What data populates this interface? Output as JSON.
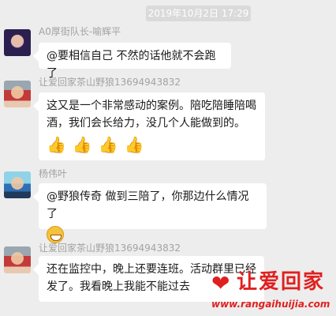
{
  "timestamp": "2019年10月2日 17:29",
  "messages": [
    {
      "sender": "A0厚街队长-喻辉平",
      "text": "@要相信自己 不然的话他就不会跑了",
      "avatar_icon": "user-avatar-icon"
    },
    {
      "sender": "让爱回家茶山野狼13694943832",
      "text": "这又是一个非常感动的案例。陪吃陪睡陪喝酒，我们会长给力，没几个人能做到的。",
      "emoji": [
        "thumbs-up-emoji",
        "thumbs-up-emoji",
        "thumbs-up-emoji",
        "thumbs-up-emoji"
      ],
      "avatar_icon": "user-avatar-icon"
    },
    {
      "sender": "杨伟叶",
      "text": "@野狼传奇 做到三陪了，你那边什么情况了",
      "emoji": [
        "grin-emoji"
      ],
      "avatar_icon": "user-avatar-icon"
    },
    {
      "sender": "让爱回家茶山野狼13694943832",
      "text": "还在监控中，晚上还要连班。活动群里已经发了。我看晚上我能不能过去",
      "avatar_icon": "user-avatar-icon"
    }
  ],
  "watermark": {
    "title": "让爱回家",
    "url": "www.rangaihuijia.com",
    "color": "#e02020"
  }
}
